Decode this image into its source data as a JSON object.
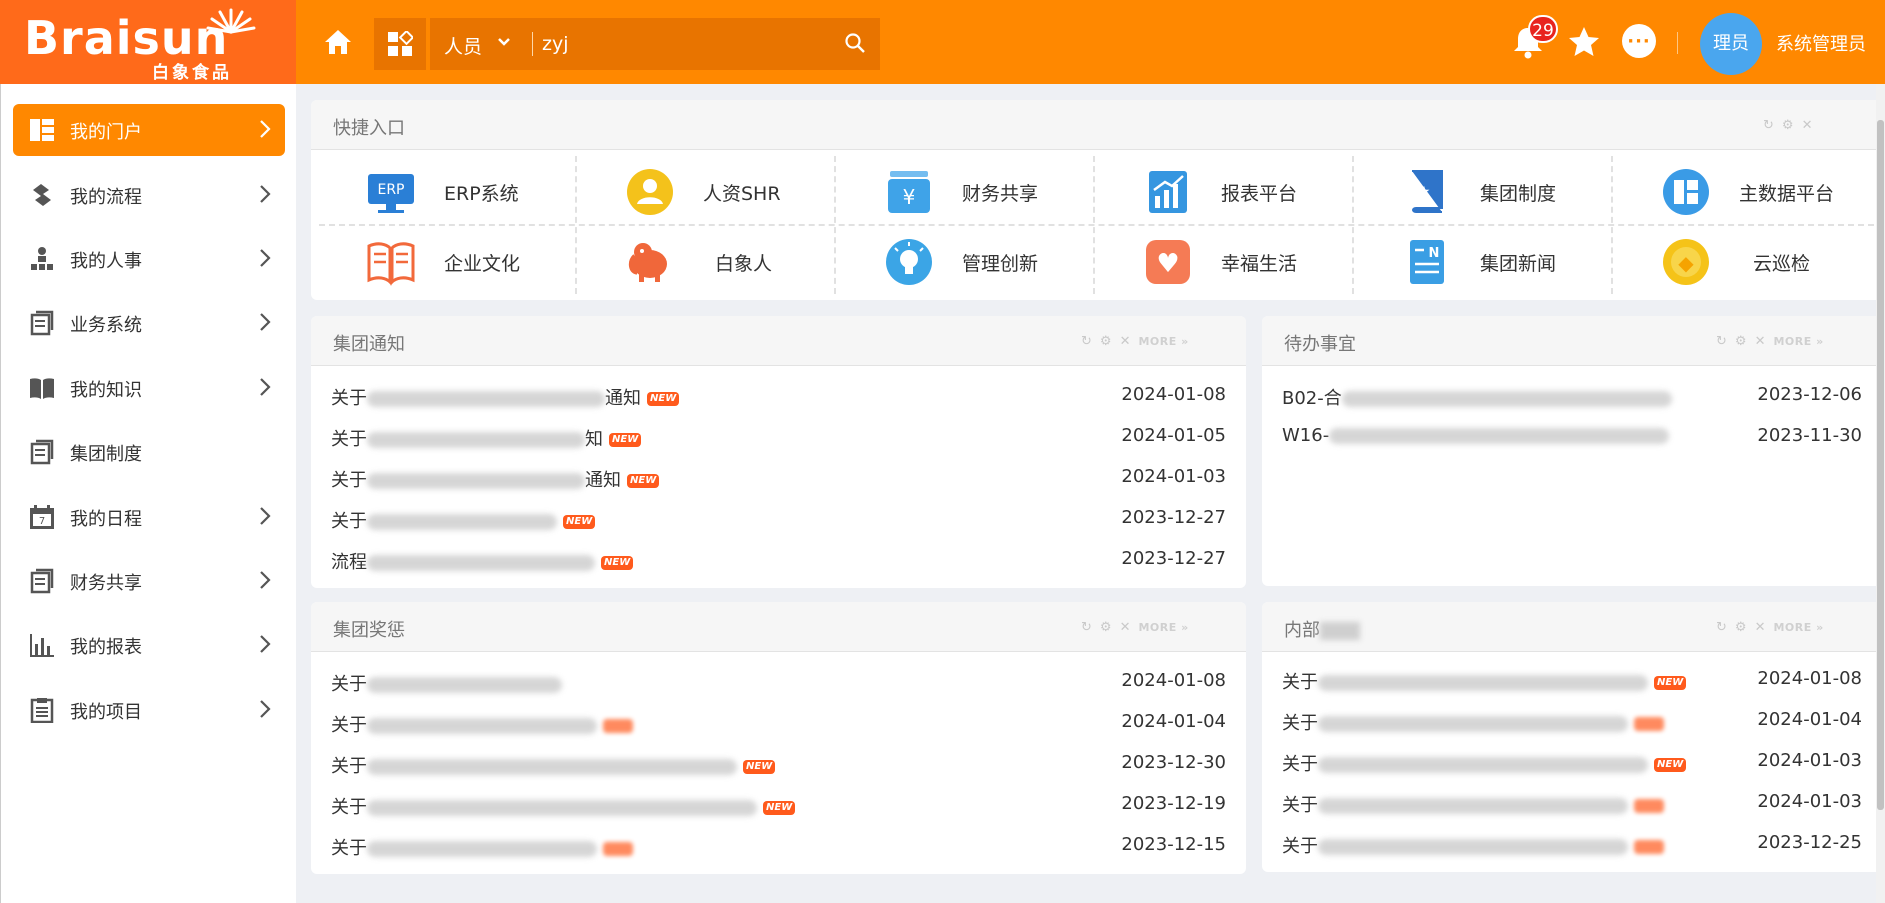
{
  "header": {
    "logo_text": "Braisun",
    "logo_sub": "白象食品",
    "search_category": "人员",
    "search_value": "zyj",
    "notification_count": "29",
    "avatar_text": "理员",
    "user_name": "系统管理员",
    "more_glyph": "···"
  },
  "sidebar": {
    "items": [
      {
        "label": "我的门户",
        "icon": "portal-icon",
        "chevron": true
      },
      {
        "label": "我的流程",
        "icon": "flow-icon",
        "chevron": true
      },
      {
        "label": "我的人事",
        "icon": "org-icon",
        "chevron": true
      },
      {
        "label": "业务系统",
        "icon": "doc-icon",
        "chevron": true
      },
      {
        "label": "我的知识",
        "icon": "book-icon",
        "chevron": true
      },
      {
        "label": "集团制度",
        "icon": "doc-icon",
        "chevron": false
      },
      {
        "label": "我的日程",
        "icon": "calendar-icon",
        "chevron": true
      },
      {
        "label": "财务共享",
        "icon": "doc-icon",
        "chevron": true
      },
      {
        "label": "我的报表",
        "icon": "chart-icon",
        "chevron": true
      },
      {
        "label": "我的项目",
        "icon": "clipboard-icon",
        "chevron": true
      }
    ],
    "calendar_day": "7"
  },
  "quick": {
    "title": "快捷入口",
    "items": [
      {
        "label": "ERP系统",
        "icon": "erp-icon",
        "color": "#2a7fd6",
        "glyph": "ERP"
      },
      {
        "label": "人资SHR",
        "icon": "hr-person-icon",
        "color": "#f4c21b",
        "glyph": ""
      },
      {
        "label": "财务共享",
        "icon": "finance-yen-icon",
        "color": "#3fa3e8",
        "glyph": "¥"
      },
      {
        "label": "报表平台",
        "icon": "report-chart-icon",
        "color": "#3596e0",
        "glyph": ""
      },
      {
        "label": "集团制度",
        "icon": "policy-book-icon",
        "color": "#2f74c9",
        "glyph": "★"
      },
      {
        "label": "主数据平台",
        "icon": "master-data-icon",
        "color": "#3a9be6",
        "glyph": ""
      },
      {
        "label": "企业文化",
        "icon": "culture-book-icon",
        "color": "#f2693b",
        "glyph": ""
      },
      {
        "label": "白象人",
        "icon": "elephant-icon",
        "color": "#f0673a",
        "glyph": ""
      },
      {
        "label": "管理创新",
        "icon": "lightbulb-icon",
        "color": "#3ba5e6",
        "glyph": ""
      },
      {
        "label": "幸福生活",
        "icon": "heart-icon",
        "color": "#f57b55",
        "glyph": "♥"
      },
      {
        "label": "集团新闻",
        "icon": "news-icon",
        "color": "#3a9ee4",
        "glyph": "N"
      },
      {
        "label": "云巡检",
        "icon": "inspection-icon",
        "color": "#f5c318",
        "glyph": "◆"
      }
    ]
  },
  "panels": {
    "more_label": "MORE",
    "notice": {
      "title": "集团通知",
      "rows": [
        {
          "prefix": "关于",
          "suffix": "通知",
          "new": true,
          "date": "2024-01-08"
        },
        {
          "prefix": "关于",
          "suffix": "知",
          "new": true,
          "date": "2024-01-05"
        },
        {
          "prefix": "关于",
          "suffix": "通知",
          "new": true,
          "date": "2024-01-03"
        },
        {
          "prefix": "关于",
          "suffix": "",
          "new": true,
          "date": "2023-12-27"
        },
        {
          "prefix": "流程",
          "suffix": "",
          "new": true,
          "date": "2023-12-27"
        }
      ]
    },
    "todo": {
      "title": "待办事宜",
      "rows": [
        {
          "prefix": "B02-合",
          "suffix": "",
          "new": false,
          "date": "2023-12-06"
        },
        {
          "prefix": "W16-",
          "suffix": "",
          "new": false,
          "date": "2023-11-30"
        }
      ]
    },
    "awards": {
      "title": "集团奖惩",
      "rows": [
        {
          "prefix": "关于",
          "suffix": "",
          "new": false,
          "date": "2024-01-08"
        },
        {
          "prefix": "关于",
          "suffix": "",
          "new": true,
          "date": "2024-01-04"
        },
        {
          "prefix": "关于",
          "suffix": "",
          "new": true,
          "date": "2023-12-30"
        },
        {
          "prefix": "关于",
          "suffix": "",
          "new": true,
          "date": "2023-12-19"
        },
        {
          "prefix": "关于",
          "suffix": "",
          "new": true,
          "date": "2023-12-15"
        }
      ]
    },
    "internal": {
      "title": "内部",
      "rows": [
        {
          "prefix": "关于",
          "suffix": "",
          "new": true,
          "date": "2024-01-08"
        },
        {
          "prefix": "关于",
          "suffix": "",
          "new": true,
          "date": "2024-01-04"
        },
        {
          "prefix": "关于",
          "suffix": "",
          "new": true,
          "date": "2024-01-03"
        },
        {
          "prefix": "关于",
          "suffix": "",
          "new": true,
          "date": "2024-01-03"
        },
        {
          "prefix": "关于",
          "suffix": "",
          "new": true,
          "date": "2023-12-25"
        }
      ]
    },
    "new_badge": "NEW"
  },
  "colors": {
    "brand_orange": "#ff8800",
    "logo_orange": "#ff6a1a",
    "badge_red": "#e8241f",
    "avatar_blue": "#4aa6ee"
  }
}
